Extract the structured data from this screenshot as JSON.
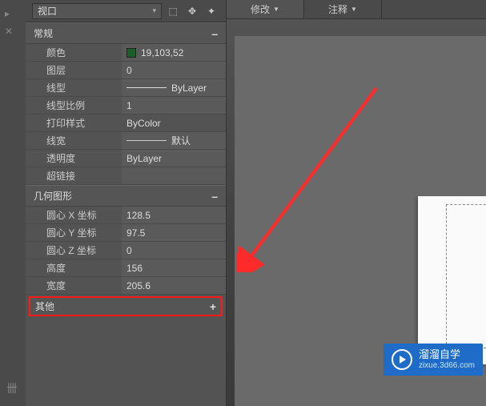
{
  "dropdown": {
    "label": "视口"
  },
  "tabs": {
    "modify": "修改",
    "annotate": "注释"
  },
  "sections": {
    "general": {
      "title": "常规",
      "toggle": "–"
    },
    "geometry": {
      "title": "几何图形",
      "toggle": "–"
    },
    "misc": {
      "title": "其他",
      "toggle": "+"
    }
  },
  "general": {
    "color_label": "颜色",
    "color_value": "19,103,52",
    "layer_label": "图层",
    "layer_value": "0",
    "linetype_label": "线型",
    "linetype_value": "ByLayer",
    "ltscale_label": "线型比例",
    "ltscale_value": "1",
    "plotstyle_label": "打印样式",
    "plotstyle_value": "ByColor",
    "lineweight_label": "线宽",
    "lineweight_value": "默认",
    "transparency_label": "透明度",
    "transparency_value": "ByLayer",
    "hyperlink_label": "超链接",
    "hyperlink_value": ""
  },
  "geometry": {
    "cx_label": "圆心 X 坐标",
    "cx_value": "128.5",
    "cy_label": "圆心 Y 坐标",
    "cy_value": "97.5",
    "cz_label": "圆心 Z 坐标",
    "cz_value": "0",
    "height_label": "高度",
    "height_value": "156",
    "width_label": "宽度",
    "width_value": "205.6"
  },
  "watermark": {
    "title": "溜溜自学",
    "sub": "zixue.3d66.com"
  }
}
